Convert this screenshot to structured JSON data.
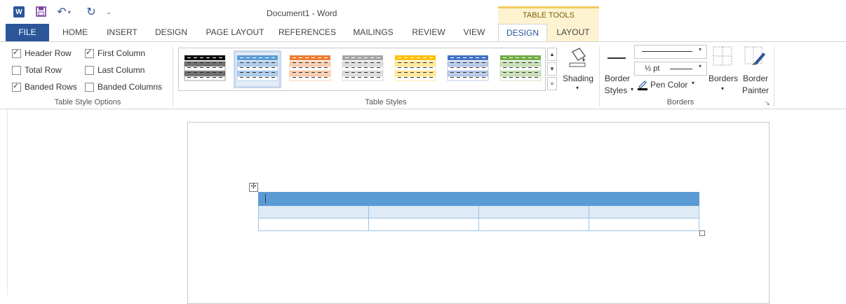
{
  "titlebar": {
    "word_logo": "W",
    "title": "Document1 - Word",
    "contextual_band": "TABLE TOOLS",
    "icons": [
      "word-icon",
      "save-icon",
      "undo-icon",
      "redo-icon",
      "customize-qat-icon"
    ]
  },
  "tabs": [
    {
      "label": "FILE"
    },
    {
      "label": "HOME"
    },
    {
      "label": "INSERT"
    },
    {
      "label": "DESIGN"
    },
    {
      "label": "PAGE LAYOUT"
    },
    {
      "label": "REFERENCES"
    },
    {
      "label": "MAILINGS"
    },
    {
      "label": "REVIEW"
    },
    {
      "label": "VIEW"
    },
    {
      "label": "DESIGN"
    },
    {
      "label": "LAYOUT"
    }
  ],
  "table_style_options": {
    "header_row": {
      "label": "Header Row",
      "checked": true
    },
    "first_column": {
      "label": "First Column",
      "checked": true
    },
    "total_row": {
      "label": "Total Row",
      "checked": false
    },
    "last_column": {
      "label": "Last Column",
      "checked": false
    },
    "banded_rows": {
      "label": "Banded Rows",
      "checked": true
    },
    "banded_columns": {
      "label": "Banded Columns",
      "checked": false
    },
    "group_label": "Table Style Options"
  },
  "table_styles": {
    "group_label": "Table Styles",
    "gallery_colors": [
      "#000000",
      "#5b9bd5",
      "#ed7d31",
      "#a5a5a5",
      "#ffc000",
      "#4472c4",
      "#70ad47"
    ],
    "shading_label": "Shading"
  },
  "borders": {
    "border_styles_label_1": "Border",
    "border_styles_label_2": "Styles",
    "weight_value": "½ pt",
    "pen_color_label": "Pen Color",
    "borders_label": "Borders",
    "border_painter_label_1": "Border",
    "border_painter_label_2": "Painter",
    "group_label": "Borders"
  },
  "colors": {
    "accent": "#2b579a",
    "contextual": "#fdf3d0",
    "table_header": "#5b9bd5",
    "table_band": "#deeaf6"
  }
}
